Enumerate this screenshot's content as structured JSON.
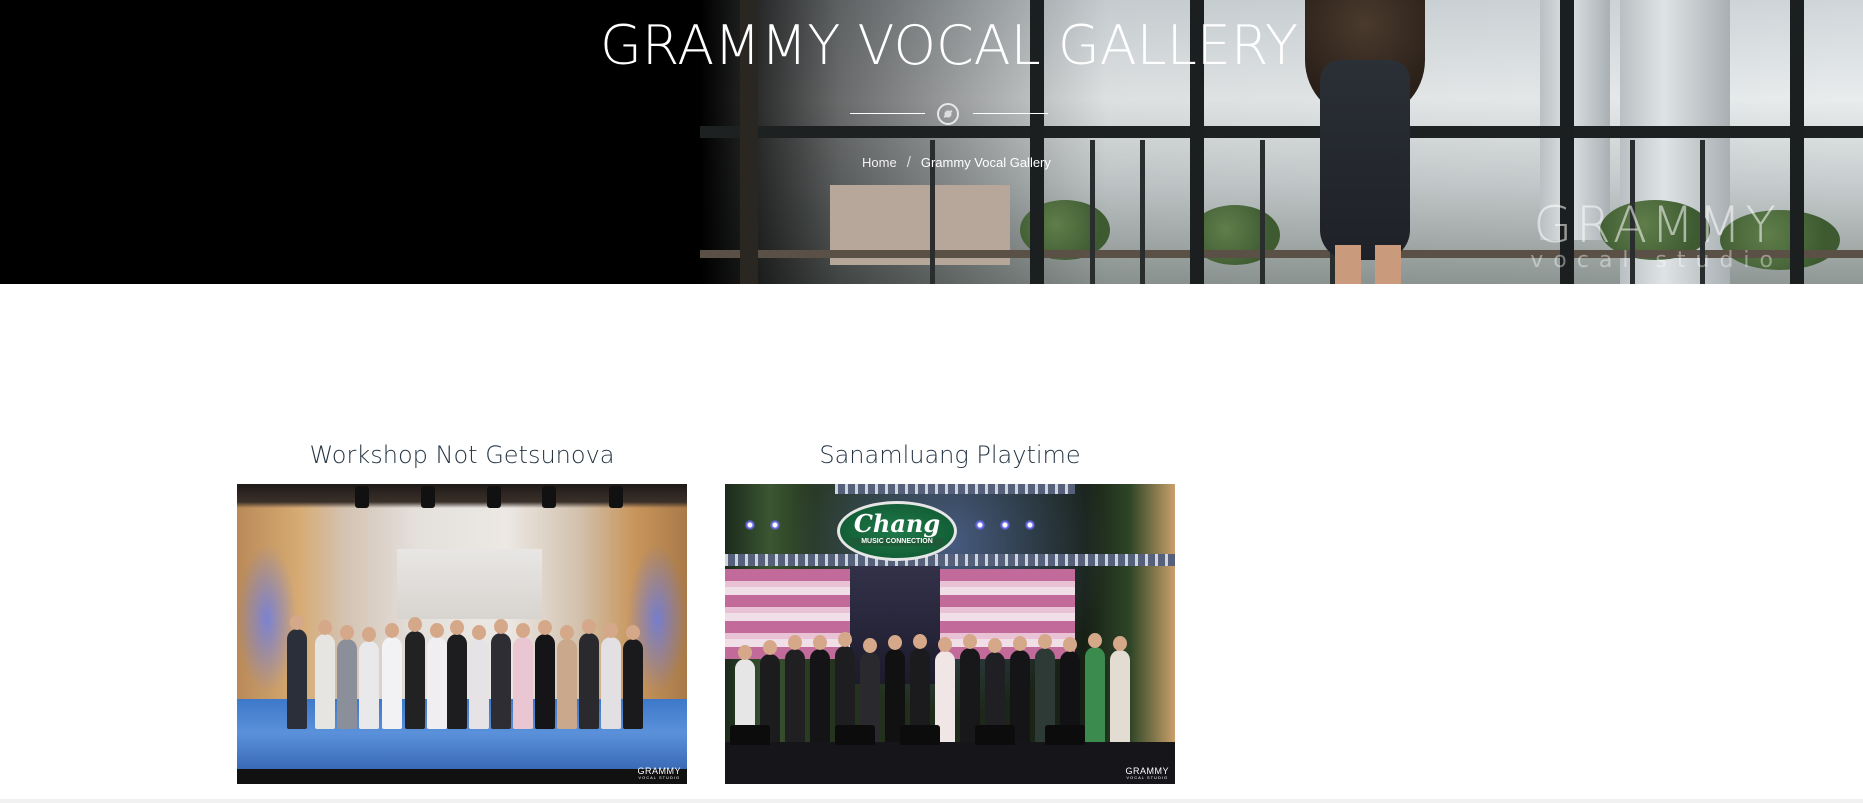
{
  "hero": {
    "title": "GRAMMY VOCAL GALLERY",
    "breadcrumb": {
      "home": "Home",
      "separator": "/",
      "current": "Grammy Vocal Gallery"
    },
    "watermark": {
      "brand": "GRAMMY",
      "sub": "vocal studio"
    },
    "divider_icon": "cd-disc-icon"
  },
  "gallery": {
    "items": [
      {
        "caption": "Workshop Not Getsunova",
        "thumb_logo": "GRAMMY",
        "thumb_logo_sub": "VOCAL STUDIO"
      },
      {
        "caption": "Sanamluang Playtime",
        "thumb_logo": "GRAMMY",
        "thumb_logo_sub": "VOCAL STUDIO",
        "sign_text": "Chang",
        "sign_sub": "MUSIC CONNECTION"
      }
    ]
  },
  "colors": {
    "hero_bg": "#000000",
    "caption_text": "#253544",
    "page_bg": "#ffffff"
  }
}
